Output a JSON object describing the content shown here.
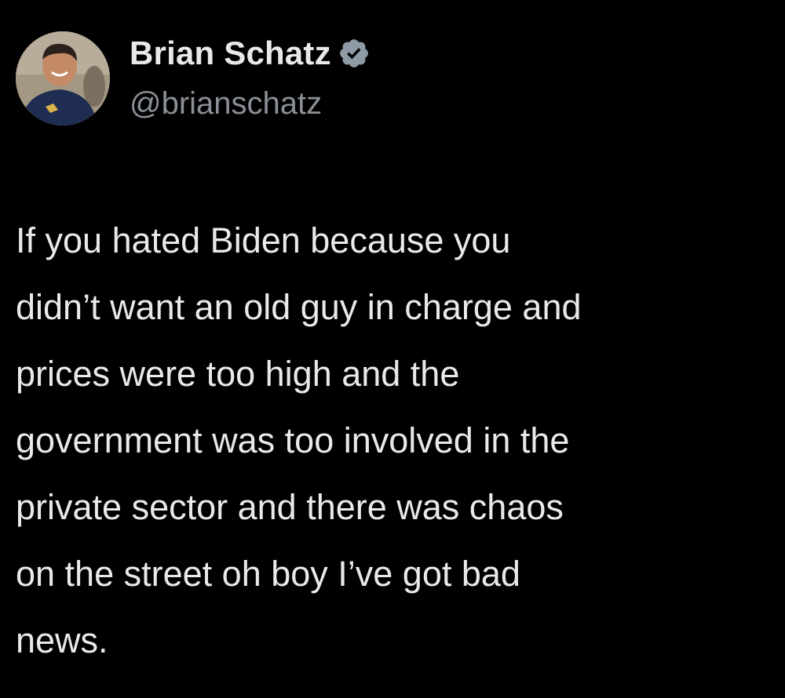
{
  "tweet": {
    "author": {
      "display_name": "Brian Schatz",
      "handle": "@brianschatz",
      "verified": true,
      "verified_icon": "verified-badge-icon",
      "avatar": "profile-photo"
    },
    "text": "If you hated Biden because you\ndidn’t want an old guy in charge and\nprices were too high and the\ngovernment was too involved in the\nprivate sector and there was chaos\non the street oh boy I’ve got bad\nnews."
  },
  "colors": {
    "background": "#000000",
    "text_primary": "#e7e9ea",
    "text_secondary": "#8b9097",
    "verified_badge": "#8e9aa6"
  }
}
